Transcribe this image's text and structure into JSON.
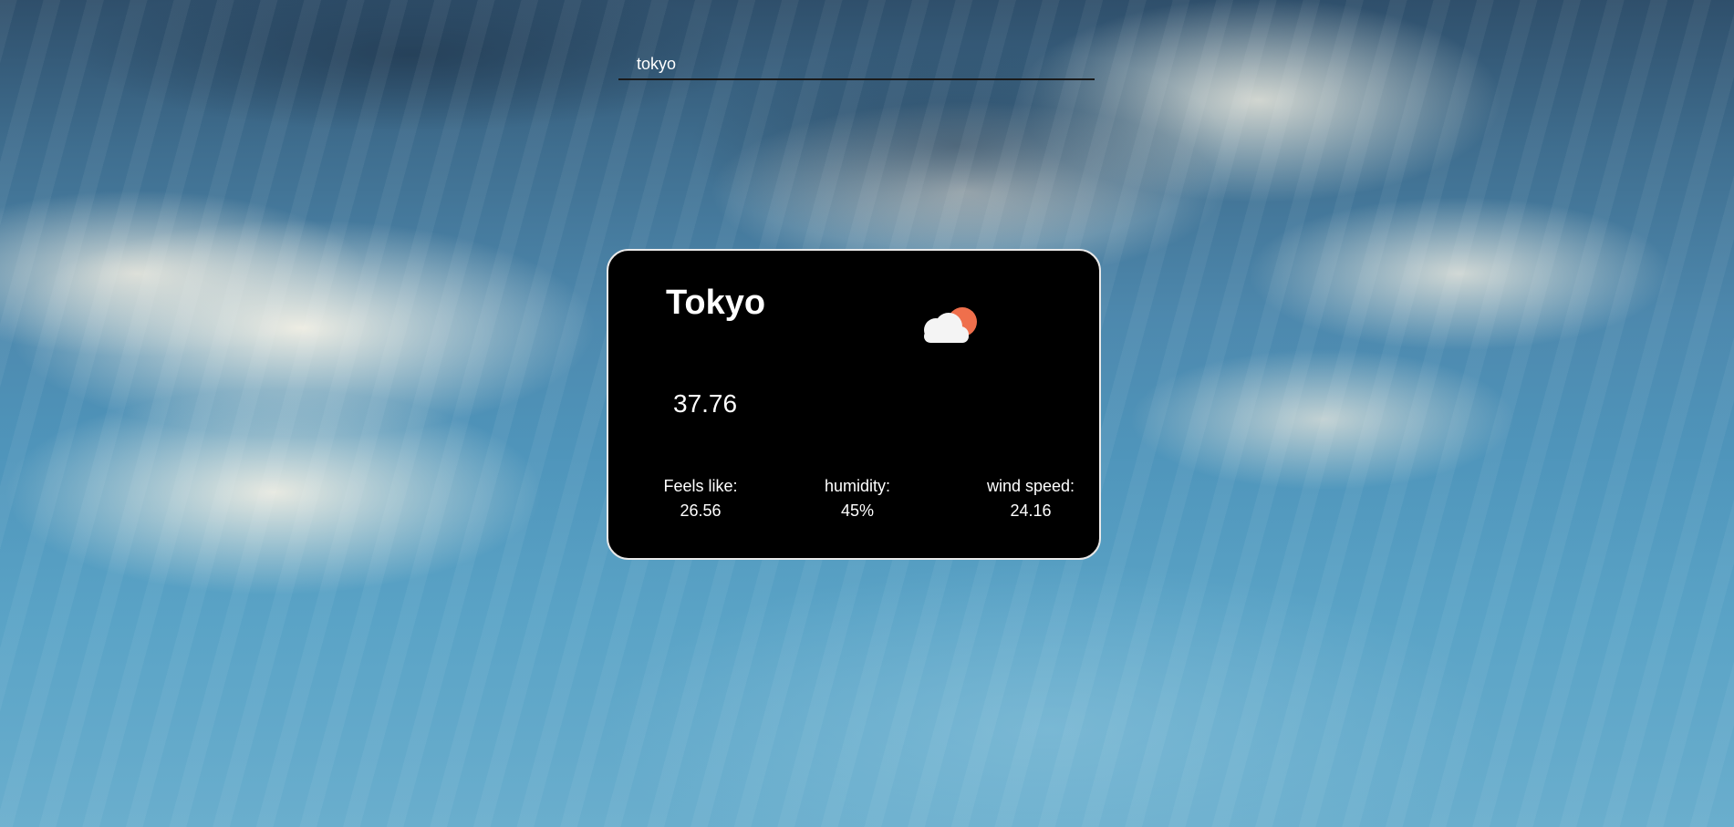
{
  "search": {
    "value": "tokyo"
  },
  "weather": {
    "city": "Tokyo",
    "temperature": "37.76",
    "icon": "partly-cloudy-icon",
    "feels_like_label": "Feels like:",
    "feels_like_value": "26.56",
    "humidity_label": "humidity:",
    "humidity_value": "45%",
    "wind_label": "wind speed:",
    "wind_value": "24.16"
  },
  "colors": {
    "card_background": "#000000",
    "card_border": "#e9e9e9",
    "sun": "#ef6f4c",
    "cloud": "#f4f4f4"
  }
}
